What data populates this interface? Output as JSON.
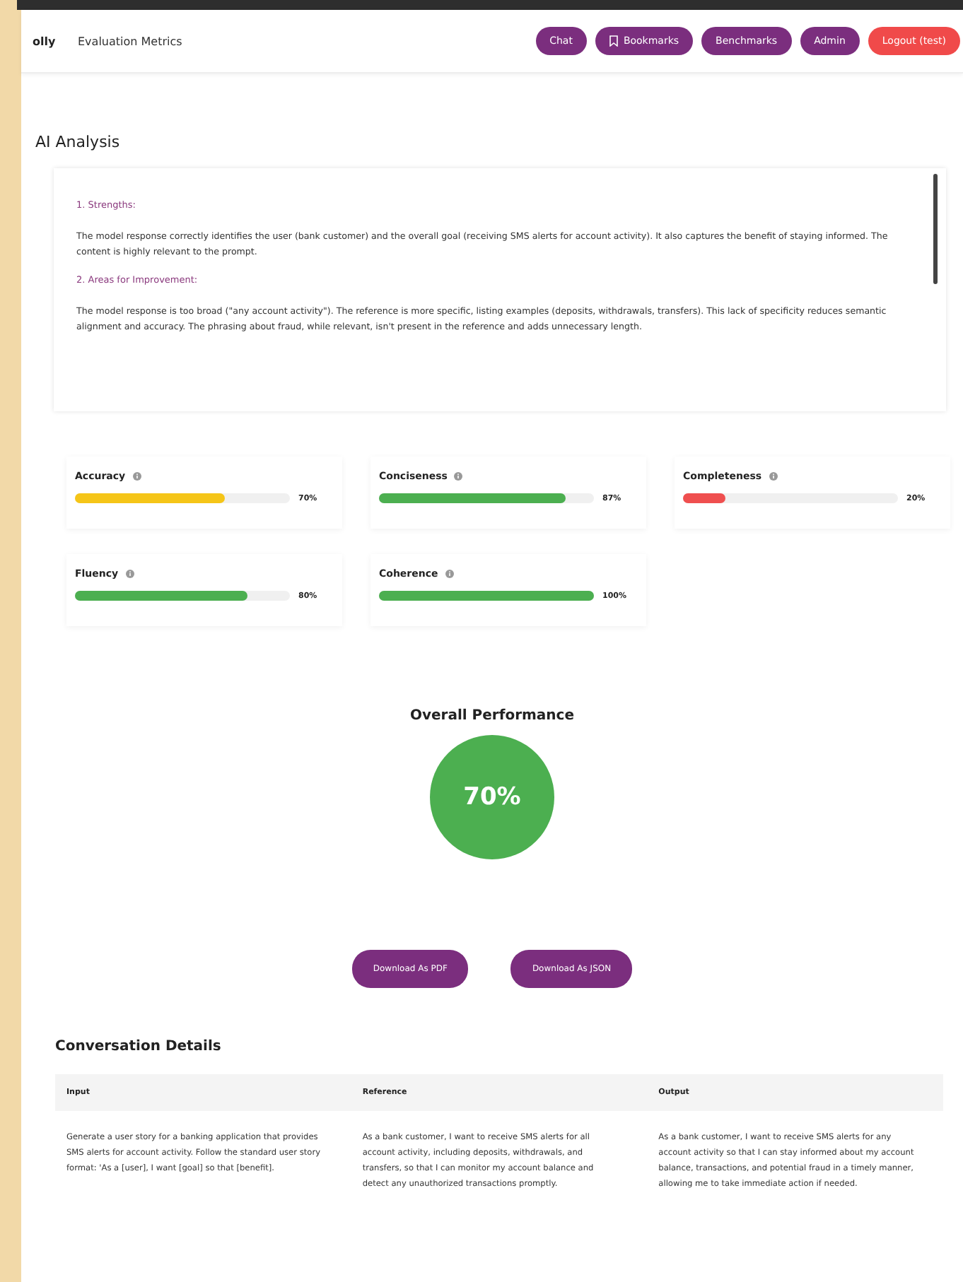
{
  "header": {
    "logo": "olly",
    "title": "Evaluation Metrics",
    "nav": [
      {
        "label": "Chat",
        "kind": "plain"
      },
      {
        "label": "Bookmarks",
        "kind": "bookmark"
      },
      {
        "label": "Benchmarks",
        "kind": "plain"
      },
      {
        "label": "Admin",
        "kind": "plain"
      },
      {
        "label": "Logout (test)",
        "kind": "danger"
      }
    ]
  },
  "analysis": {
    "title": "AI Analysis",
    "sections": [
      {
        "heading": "1. Strengths:",
        "text": "The model response correctly identifies the user (bank customer) and the overall goal (receiving SMS alerts for account activity). It also captures the benefit of staying informed. The content is highly relevant to the prompt."
      },
      {
        "heading": "2. Areas for Improvement:",
        "text": "The model response is too broad (\"any account activity\"). The reference is more specific, listing examples (deposits, withdrawals, transfers). This lack of specificity reduces semantic alignment and accuracy. The phrasing about fraud, while relevant, isn't present in the reference and adds unnecessary length."
      }
    ]
  },
  "metrics": [
    {
      "name": "Accuracy",
      "level": 0.7,
      "reading": "70%",
      "color": "#f5c518"
    },
    {
      "name": "Conciseness",
      "level": 0.87,
      "reading": "87%",
      "color": "#4caf50"
    },
    {
      "name": "Completeness",
      "level": 0.2,
      "reading": "20%",
      "color": "#ef4f4f"
    },
    {
      "name": "Fluency",
      "level": 0.8,
      "reading": "80%",
      "color": "#4caf50"
    },
    {
      "name": "Coherence",
      "level": 1,
      "reading": "100%",
      "color": "#4caf50"
    }
  ],
  "overall": {
    "title": "Overall Performance",
    "score": "70%"
  },
  "downloads": [
    "Download As PDF",
    "Download As JSON"
  ],
  "conversation": {
    "title": "Conversation Details",
    "columns": [
      "Input",
      "Reference",
      "Output"
    ],
    "rows": [
      [
        "Generate a user story for a banking application that provides SMS alerts for account activity. Follow the standard user story format: 'As a [user], I want [goal] so that [benefit].",
        "As a bank customer, I want to receive SMS alerts for all account activity, including deposits, withdrawals, and transfers, so that I can monitor my account balance and detect any unauthorized transactions promptly.",
        "As a bank customer, I want to receive SMS alerts for any account activity so that I can stay informed about my account balance, transactions, and potential fraud in a timely manner, allowing me to take immediate action if needed."
      ]
    ]
  }
}
